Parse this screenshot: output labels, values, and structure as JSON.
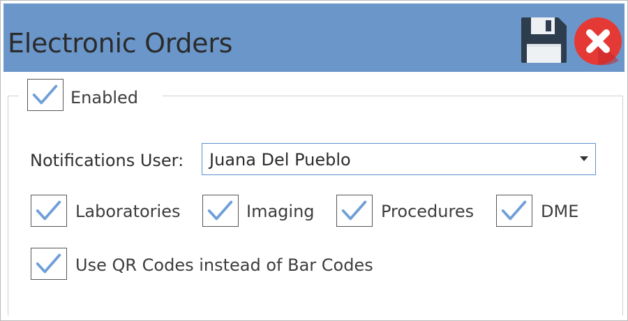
{
  "window": {
    "title": "Electronic Orders",
    "save_icon": "floppy-disk-icon",
    "close_icon": "red-circle-x-icon"
  },
  "enabled": {
    "label": "Enabled",
    "checked": true
  },
  "notifications_user": {
    "label": "Notifications User:",
    "value": "Juana Del Pueblo"
  },
  "order_types": [
    {
      "label": "Laboratories",
      "checked": true
    },
    {
      "label": "Imaging",
      "checked": true
    },
    {
      "label": "Procedures",
      "checked": true
    },
    {
      "label": "DME",
      "checked": true
    }
  ],
  "qr_codes": {
    "label": "Use QR Codes instead of Bar Codes",
    "checked": true
  },
  "colors": {
    "header_bg": "#6a96ca",
    "check_mark": "#6f9fd8",
    "close_red": "#e53935",
    "combo_border": "#5b8fd0"
  }
}
